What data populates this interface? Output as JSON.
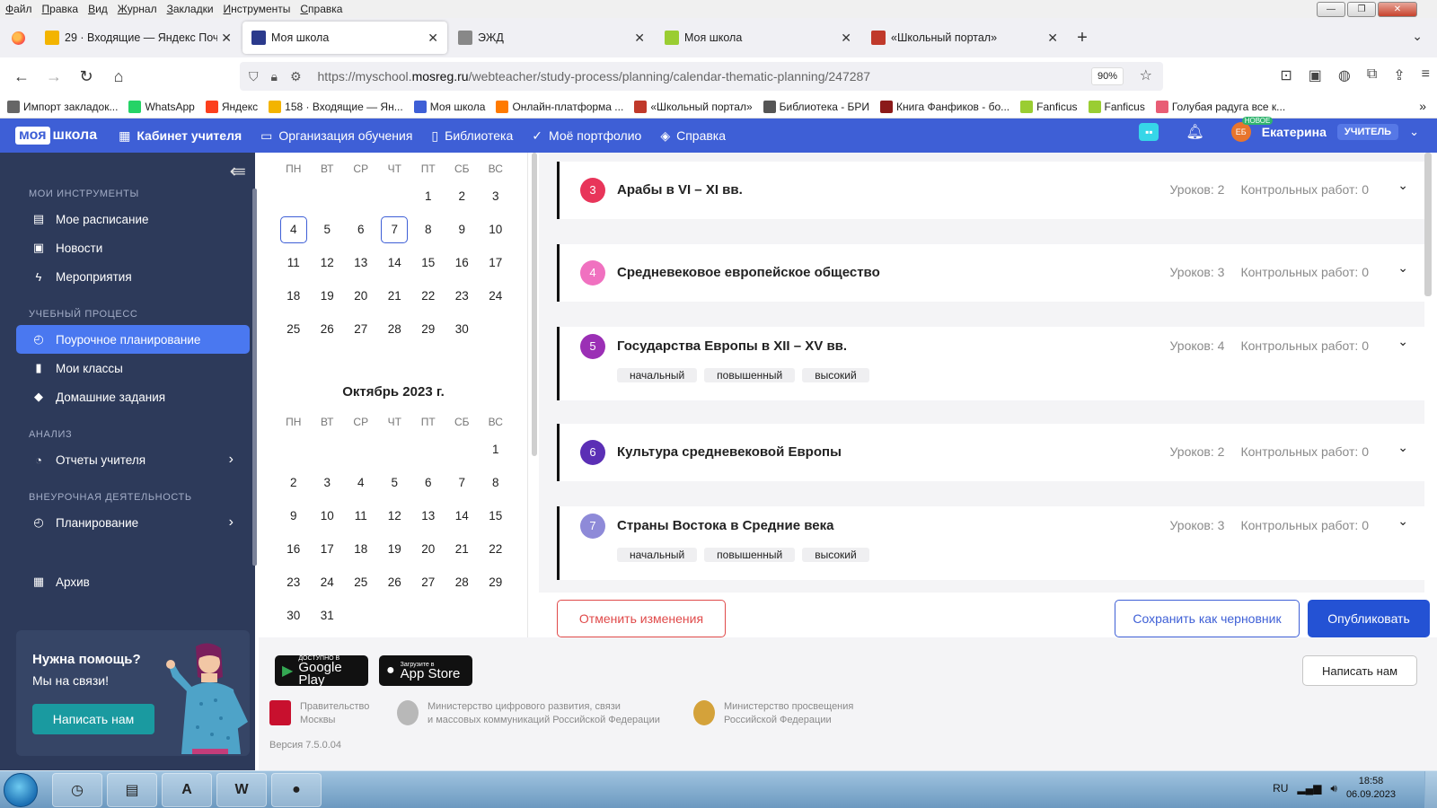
{
  "menubar": {
    "items": [
      "Файл",
      "Правка",
      "Вид",
      "Журнал",
      "Закладки",
      "Инструменты",
      "Справка"
    ]
  },
  "window_controls": {
    "minimize": "—",
    "maximize": "❐",
    "close": "✕"
  },
  "tabs": [
    {
      "label": "29 · Входящие — Яндекс Почта",
      "icon": "yandex-mail-icon",
      "color": "#f3b400",
      "active": false
    },
    {
      "label": "Моя школа",
      "icon": "myschool-icon",
      "color": "#2b3a8c",
      "active": true
    },
    {
      "label": "ЭЖД",
      "icon": "document-icon",
      "color": "#888888",
      "active": false
    },
    {
      "label": "Моя школа",
      "icon": "leaf-icon",
      "color": "#9acd32",
      "active": false
    },
    {
      "label": "«Школьный портал»",
      "icon": "portal-icon",
      "color": "#c0392b",
      "active": false
    }
  ],
  "navbar": {
    "url_prefix": "https://myschool.",
    "url_host": "mosreg.ru",
    "url_path": "/webteacher/study-process/planning/calendar-thematic-planning/247287",
    "zoom": "90%"
  },
  "bookmarks": [
    {
      "label": "Импорт закладок...",
      "color": "#666666"
    },
    {
      "label": "WhatsApp",
      "color": "#25d366"
    },
    {
      "label": "Яндекс",
      "color": "#fc3f1d"
    },
    {
      "label": "158 · Входящие — Ян...",
      "color": "#f3b400"
    },
    {
      "label": "Моя школа",
      "color": "#3e5fd6"
    },
    {
      "label": "Онлайн-платформа ...",
      "color": "#ff7a00"
    },
    {
      "label": "«Школьный портал»",
      "color": "#c0392b"
    },
    {
      "label": "Библиотека - БРИ",
      "color": "#555555"
    },
    {
      "label": "Книга Фанфиков - бо...",
      "color": "#8b1a1a"
    },
    {
      "label": "Fanficus",
      "color": "#9acd32"
    },
    {
      "label": "Fanficus",
      "color": "#9acd32"
    },
    {
      "label": "Голубая радуга все к...",
      "color": "#e85d75"
    }
  ],
  "header": {
    "logo_box": "моя",
    "logo_text": "школа",
    "nav": [
      {
        "label": "Кабинет учителя",
        "icon": "grid-icon",
        "bold": true
      },
      {
        "label": "Организация обучения",
        "icon": "monitor-icon",
        "bold": false
      },
      {
        "label": "Библиотека",
        "icon": "bookmark-icon",
        "bold": false
      },
      {
        "label": "Моё портфолио",
        "icon": "check-circle-icon",
        "bold": false
      },
      {
        "label": "Справка",
        "icon": "diamond-icon",
        "bold": false
      }
    ],
    "avatar_initials": "ЕБ",
    "new_badge": "НОВОЕ",
    "user_name": "Екатерина",
    "role": "УЧИТЕЛЬ"
  },
  "sidebar": {
    "sections": [
      {
        "title": "МОИ ИНСТРУМЕНТЫ",
        "items": [
          {
            "label": "Мое расписание",
            "icon": "calendar-icon"
          },
          {
            "label": "Новости",
            "icon": "news-icon"
          },
          {
            "label": "Мероприятия",
            "icon": "lightning-icon"
          }
        ]
      },
      {
        "title": "УЧЕБНЫЙ ПРОЦЕСС",
        "items": [
          {
            "label": "Поурочное планирование",
            "icon": "clock-icon",
            "active": true
          },
          {
            "label": "Мои классы",
            "icon": "book-icon"
          },
          {
            "label": "Домашние задания",
            "icon": "graduation-cap-icon"
          }
        ]
      },
      {
        "title": "АНАЛИЗ",
        "items": [
          {
            "label": "Отчеты учителя",
            "icon": "pie-chart-icon",
            "chevron": true
          }
        ]
      },
      {
        "title": "ВНЕУРОЧНАЯ ДЕЯТЕЛЬНОСТЬ",
        "items": [
          {
            "label": "Планирование",
            "icon": "clock-icon",
            "chevron": true
          }
        ]
      }
    ],
    "archive": {
      "label": "Архив",
      "icon": "archive-icon"
    },
    "help": {
      "title": "Нужна помощь?",
      "subtitle": "Мы на связи!",
      "button": "Написать нам"
    }
  },
  "calendar": {
    "weekdays": [
      "ПН",
      "ВТ",
      "СР",
      "ЧТ",
      "ПТ",
      "СБ",
      "ВС"
    ],
    "september": {
      "leading_blanks": 4,
      "days": [
        "1",
        "2",
        "3",
        "4",
        "5",
        "6",
        "7",
        "8",
        "9",
        "10",
        "11",
        "12",
        "13",
        "14",
        "15",
        "16",
        "17",
        "18",
        "19",
        "20",
        "21",
        "22",
        "23",
        "24",
        "25",
        "26",
        "27",
        "28",
        "29",
        "30"
      ],
      "selected": [
        "4",
        "7"
      ]
    },
    "october": {
      "title": "Октябрь 2023 г.",
      "leading_blanks": 6,
      "days": [
        "1",
        "2",
        "3",
        "4",
        "5",
        "6",
        "7",
        "8",
        "9",
        "10",
        "11",
        "12",
        "13",
        "14",
        "15",
        "16",
        "17",
        "18",
        "19",
        "20",
        "21",
        "22",
        "23",
        "24",
        "25",
        "26",
        "27",
        "28",
        "29",
        "30",
        "31"
      ]
    }
  },
  "topics": [
    {
      "num": "3",
      "title": "Арабы в VI – XI вв.",
      "lessons": "Уроков: 2",
      "tests": "Контрольных работ: 0",
      "color": "#e8355a",
      "tags": []
    },
    {
      "num": "4",
      "title": "Средневековое европейское общество",
      "lessons": "Уроков: 3",
      "tests": "Контрольных работ: 0",
      "color": "#f071c0",
      "tags": []
    },
    {
      "num": "5",
      "title": "Государства Европы в XII – XV вв.",
      "lessons": "Уроков: 4",
      "tests": "Контрольных работ: 0",
      "color": "#9b2fb5",
      "tags": [
        "начальный",
        "повышенный",
        "высокий"
      ]
    },
    {
      "num": "6",
      "title": "Культура средневековой Европы",
      "lessons": "Уроков: 2",
      "tests": "Контрольных работ: 0",
      "color": "#5b2fb5",
      "tags": []
    },
    {
      "num": "7",
      "title": "Страны Востока в Средние века",
      "lessons": "Уроков: 3",
      "tests": "Контрольных работ: 0",
      "color": "#8e8ad8",
      "tags": [
        "начальный",
        "повышенный",
        "высокий"
      ]
    }
  ],
  "actions": {
    "cancel": "Отменить изменения",
    "draft": "Сохранить как черновник",
    "publish": "Опубликовать"
  },
  "footer": {
    "google_small": "ДОСТУПНО В",
    "google_big": "Google Play",
    "apple_small": "Загрузите в",
    "apple_big": "App Store",
    "orgs": [
      {
        "line1": "Правительство",
        "line2": "Москвы"
      },
      {
        "line1": "Министерство цифрового развития, связи",
        "line2": "и массовых коммуникаций Российской Федерации"
      },
      {
        "line1": "Министерство просвещения",
        "line2": "Российской Федерации"
      }
    ],
    "version": "Версия 7.5.0.04",
    "write_us": "Написать нам"
  },
  "taskbar": {
    "apps": [
      {
        "name": "clock-app",
        "glyph": "◷"
      },
      {
        "name": "explorer-app",
        "glyph": "▤"
      },
      {
        "name": "pdf-app",
        "glyph": "A"
      },
      {
        "name": "word-app",
        "glyph": "W"
      },
      {
        "name": "firefox-app",
        "glyph": "●"
      }
    ],
    "lang": "RU",
    "time": "18:58",
    "date": "06.09.2023"
  }
}
